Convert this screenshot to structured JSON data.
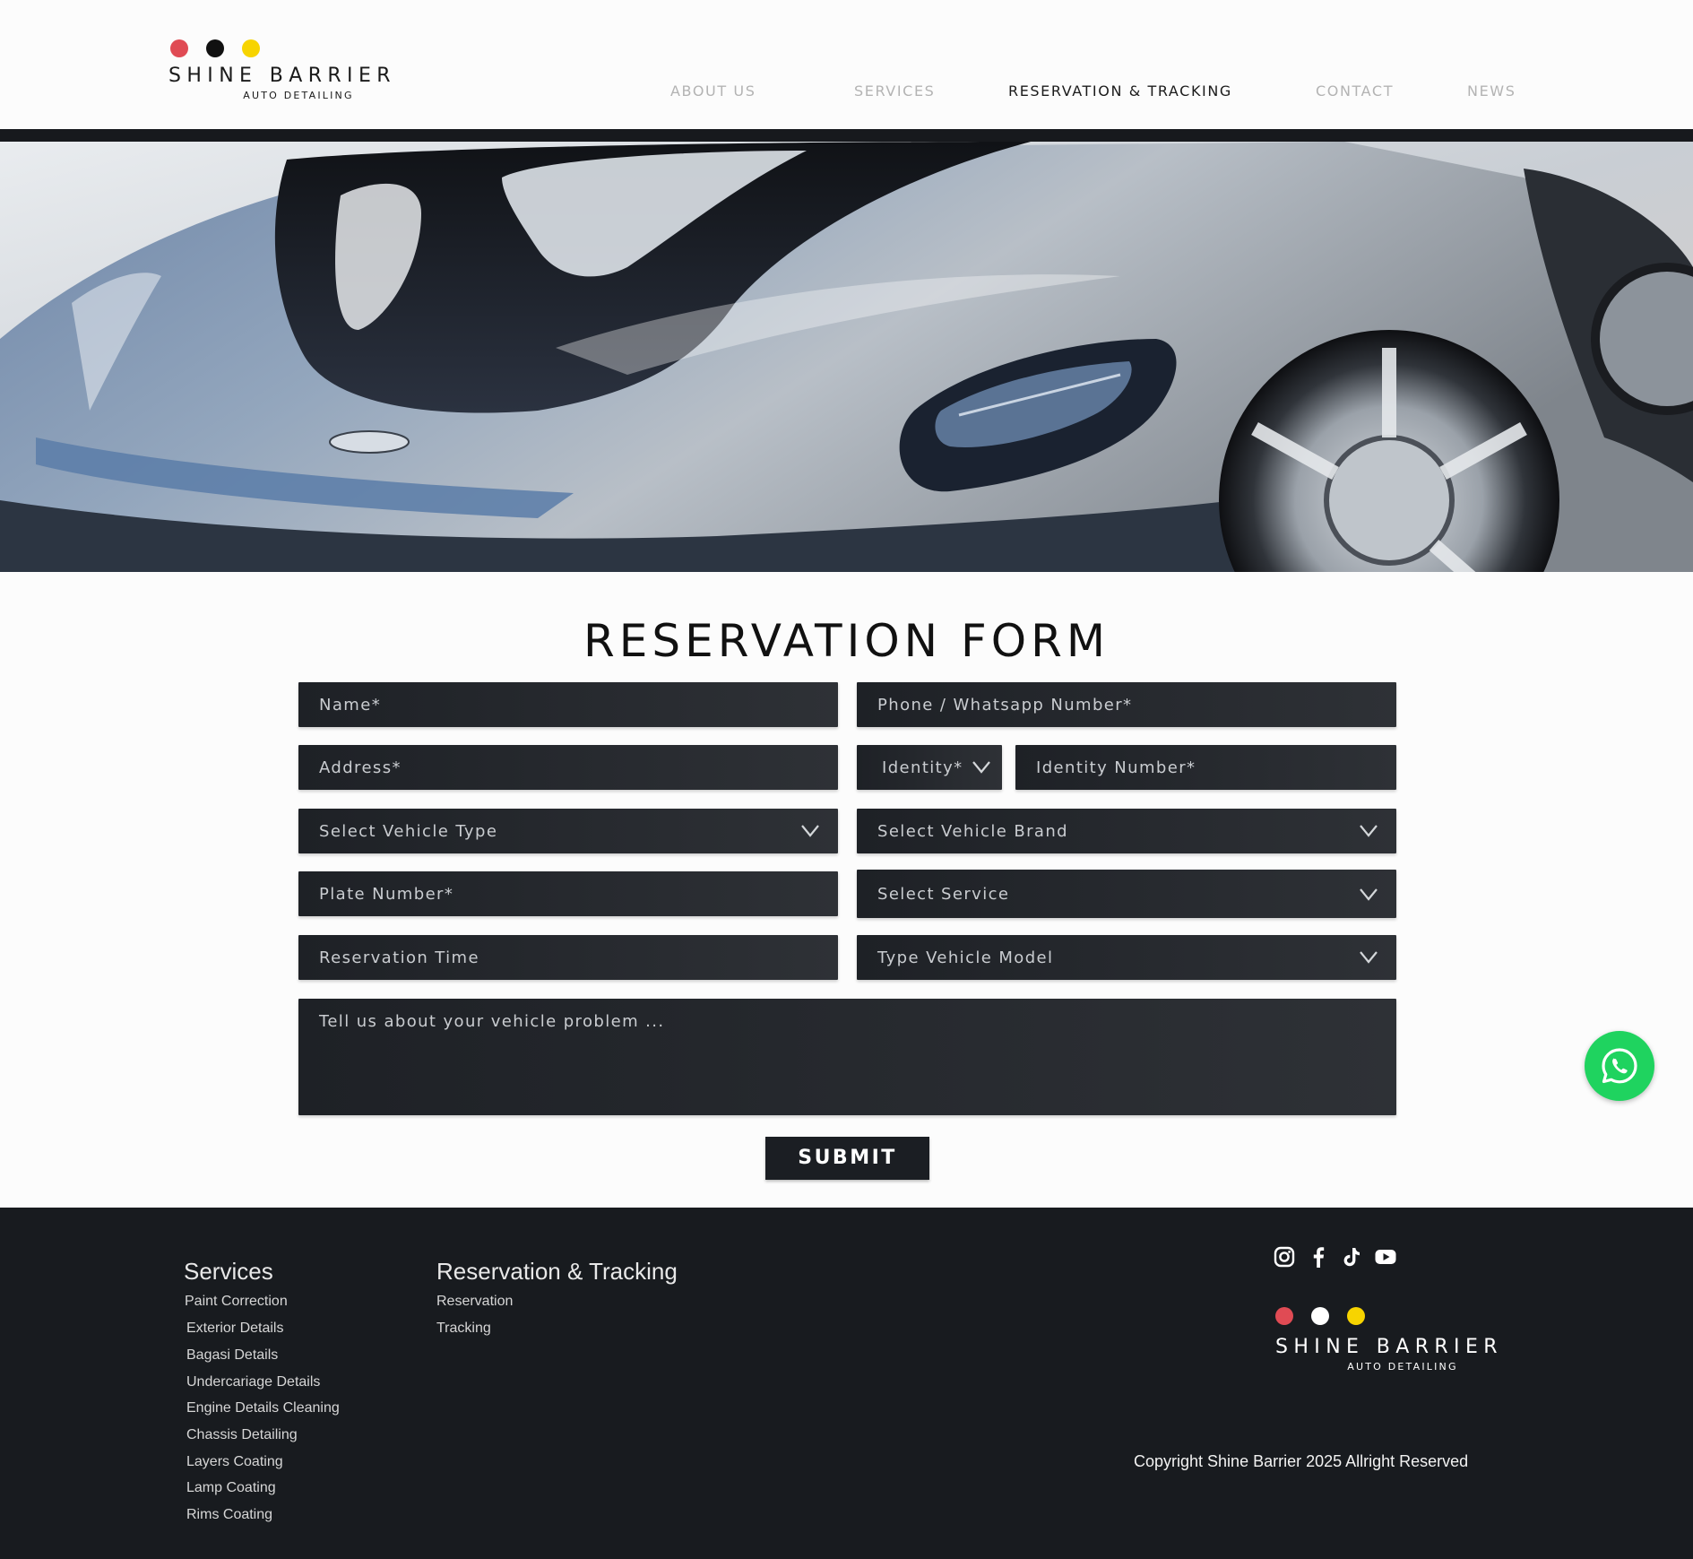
{
  "colors": {
    "dot_red": "#e04b54",
    "dot_black": "#111111",
    "dot_white": "#ffffff",
    "dot_yellow": "#f7d400",
    "field_dark": "#23262b",
    "footer_bg": "#181b1f",
    "whatsapp_green": "#1fd35f"
  },
  "header": {
    "logo": {
      "name": "SHINE BARRIER",
      "tagline": "AUTO DETAILING"
    },
    "nav": [
      {
        "label": "ABOUT US",
        "active": false
      },
      {
        "label": "SERVICES",
        "active": false
      },
      {
        "label": "RESERVATION & TRACKING",
        "active": true
      },
      {
        "label": "CONTACT",
        "active": false
      },
      {
        "label": "NEWS",
        "active": false
      }
    ]
  },
  "hero": {
    "image": "silver-blue-sports-car-headlight-closeup"
  },
  "form": {
    "title": "RESERVATION FORM",
    "fields": {
      "name": {
        "placeholder": "Name*",
        "value": ""
      },
      "phone": {
        "placeholder": "Phone / Whatsapp Number*",
        "value": ""
      },
      "address": {
        "placeholder": "Address*",
        "value": ""
      },
      "identity_type": {
        "selected": "Identity*"
      },
      "identity_number": {
        "placeholder": "Identity Number*",
        "value": ""
      },
      "vehicle_type": {
        "selected": "Select Vehicle Type"
      },
      "vehicle_brand": {
        "selected": "Select Vehicle Brand"
      },
      "plate_number": {
        "placeholder": "Plate Number*",
        "value": ""
      },
      "service": {
        "selected": "Select Service"
      },
      "reservation_time": {
        "placeholder": "Reservation Time",
        "value": ""
      },
      "vehicle_model": {
        "selected": "Type Vehicle Model"
      },
      "problem": {
        "placeholder": "Tell us about your vehicle problem ...",
        "value": ""
      }
    },
    "submit_label": "SUBMIT"
  },
  "whatsapp": {
    "icon": "whatsapp-icon"
  },
  "footer": {
    "services": {
      "heading": "Services",
      "links": [
        "Paint Correction",
        "Exterior Details",
        "Bagasi Details",
        "Undercariage Details",
        "Engine Details Cleaning",
        "Chassis Detailing",
        "Layers Coating",
        "Lamp Coating",
        "Rims Coating"
      ]
    },
    "reservation": {
      "heading": "Reservation & Tracking",
      "links": [
        "Reservation",
        "Tracking"
      ]
    },
    "social": [
      "instagram-icon",
      "facebook-icon",
      "tiktok-icon",
      "youtube-icon"
    ],
    "logo": {
      "name": "SHINE BARRIER",
      "tagline": "AUTO DETAILING"
    },
    "copyright": "Copyright Shine Barrier 2025 Allright Reserved"
  }
}
